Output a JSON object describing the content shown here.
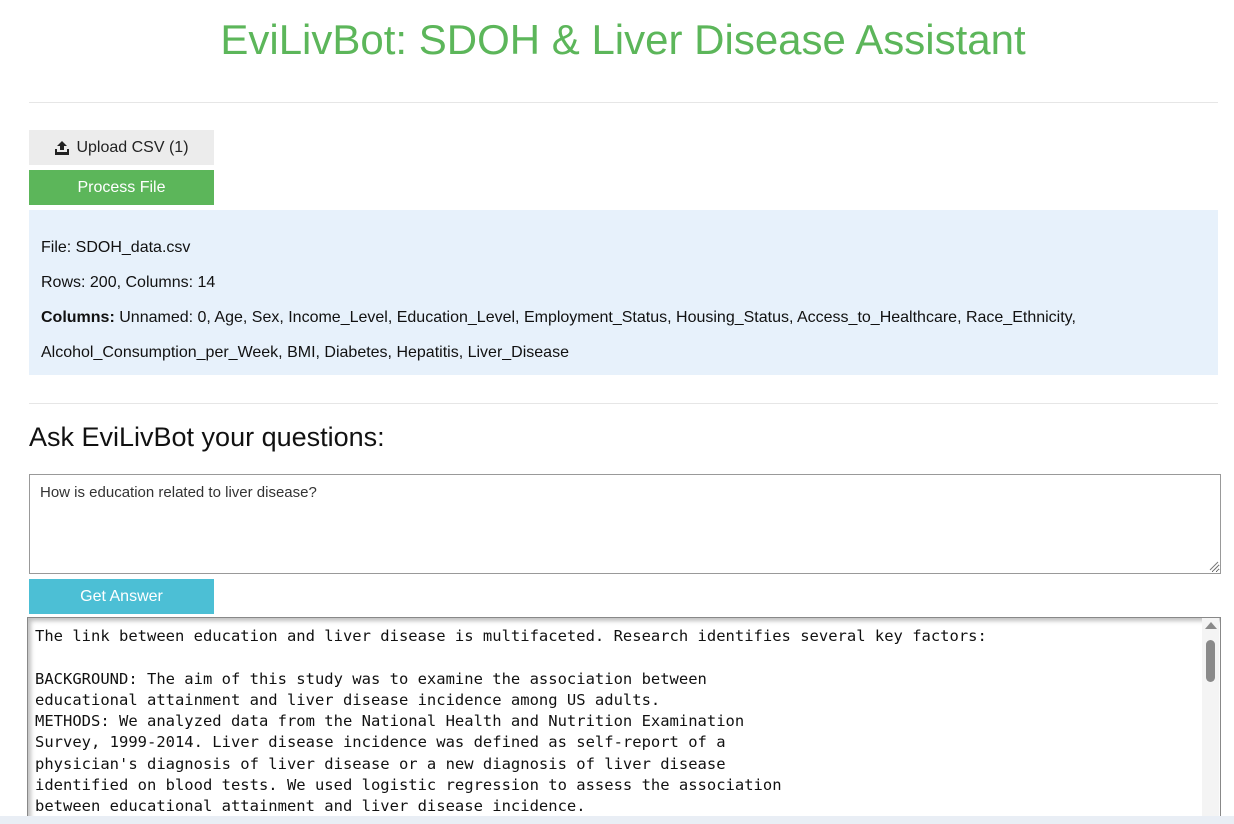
{
  "app": {
    "title": "EviLivBot: SDOH & Liver Disease Assistant",
    "accent_color": "#5cb65a"
  },
  "upload": {
    "icon": "upload-icon",
    "label": "Upload CSV (1)"
  },
  "process": {
    "label": "Process File"
  },
  "file_info": {
    "file_line": "File: SDOH_data.csv",
    "rows_line": "Rows: 200, Columns: 14",
    "columns_label": "Columns:",
    "columns_value": "Unnamed: 0, Age, Sex, Income_Level, Education_Level, Employment_Status, Housing_Status, Access_to_Healthcare, Race_Ethnicity,",
    "columns_value_2": "Alcohol_Consumption_per_Week, BMI, Diabetes, Hepatitis, Liver_Disease"
  },
  "ask": {
    "heading": "Ask EviLivBot your questions:",
    "question_value": "How is education related to liver disease?",
    "submit_label": "Get Answer",
    "submit_color": "#4cbfd5"
  },
  "answer": {
    "text": "The link between education and liver disease is multifaceted. Research identifies several key factors:\n\nBACKGROUND: The aim of this study was to examine the association between\neducational attainment and liver disease incidence among US adults.\nMETHODS: We analyzed data from the National Health and Nutrition Examination\nSurvey, 1999-2014. Liver disease incidence was defined as self-report of a\nphysician's diagnosis of liver disease or a new diagnosis of liver disease\nidentified on blood tests. We used logistic regression to assess the association\nbetween educational attainment and liver disease incidence."
  }
}
